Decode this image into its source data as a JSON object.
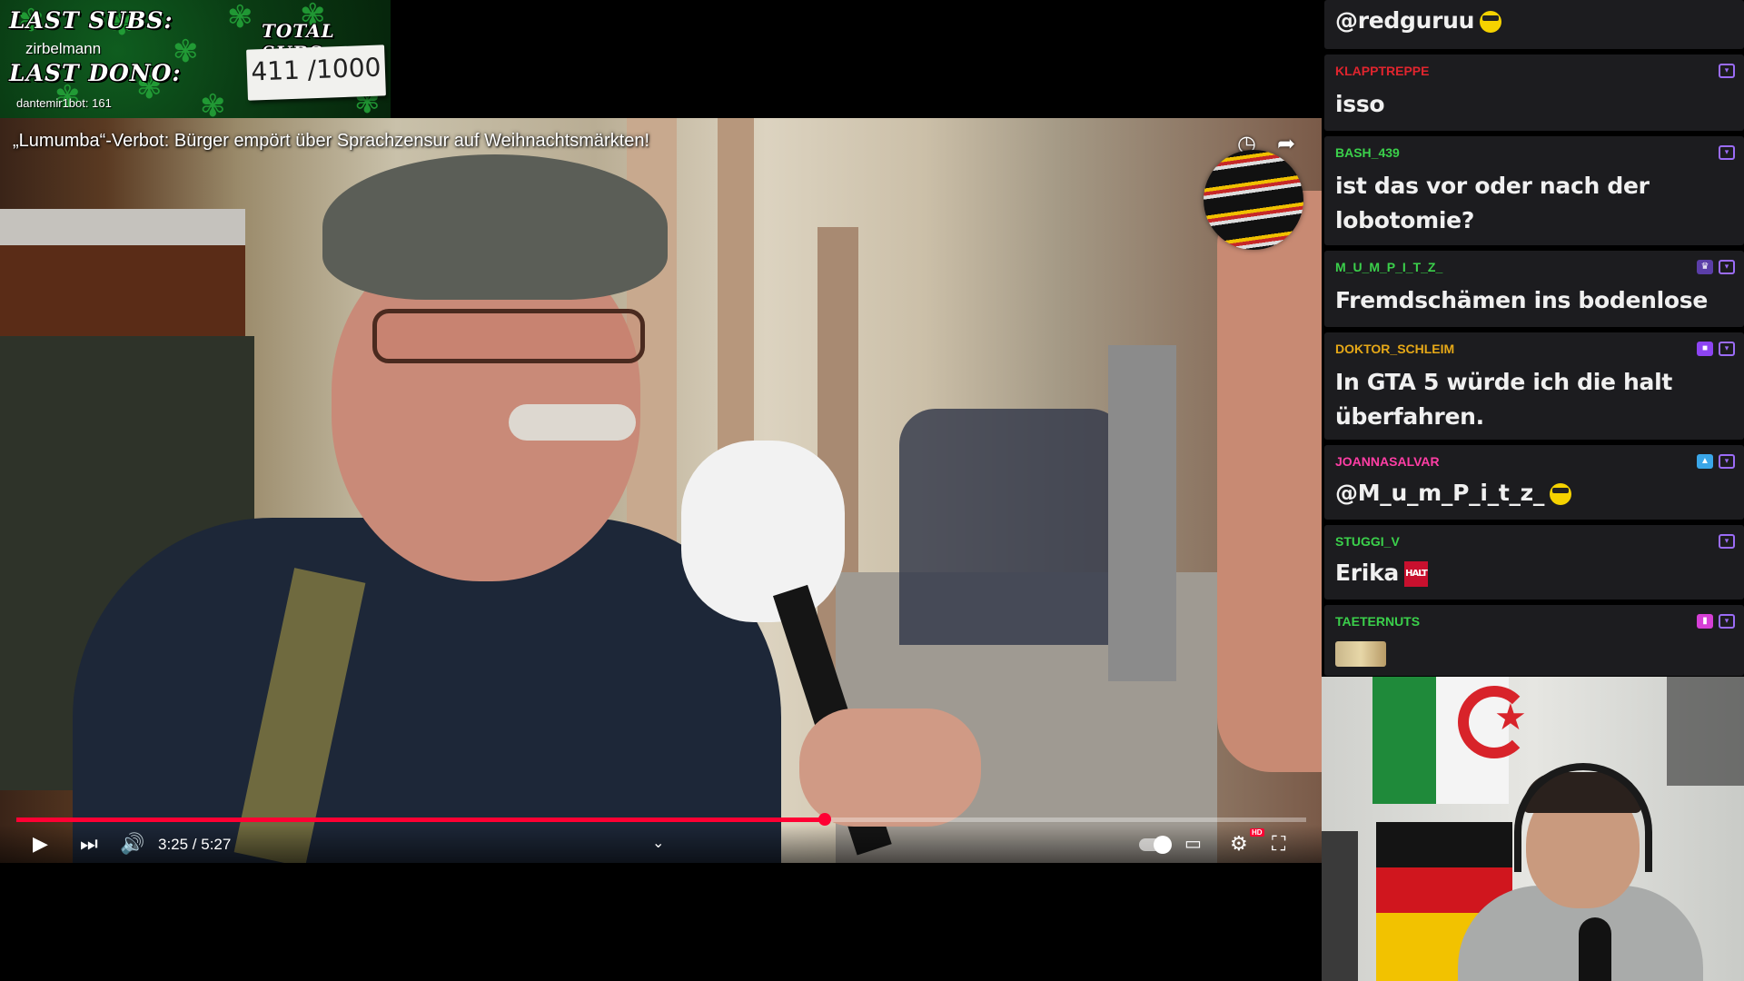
{
  "overlay": {
    "last_subs_label": "LAST SUBS:",
    "last_subs_value": "zirbelmann",
    "last_dono_label": "LAST DONO:",
    "last_dono_value": "dantemir1bot: 161",
    "total_subs_label": "TOTAL SUBS",
    "total_subs_value": "411 /1000"
  },
  "video": {
    "title": "„Lumumba“-Verbot: Bürger empört über Sprachzensur auf Weihnachtsmärkten!",
    "current_time": "3:25",
    "duration": "5:27",
    "time_display": "3:25 / 5:27",
    "progress_fraction": 0.627,
    "icons": {
      "watch_later": "clock-icon",
      "share": "share-icon",
      "play": "play-icon",
      "next": "next-icon",
      "volume": "volume-icon",
      "chapters": "chevron-down-icon",
      "autoplay": "autoplay-toggle",
      "subtitles": "subtitles-icon",
      "settings": "settings-icon",
      "fullscreen_exit": "fullscreen-exit-icon"
    },
    "hd_badge": "HD"
  },
  "chat": {
    "messages": [
      {
        "user": "",
        "user_color": "#ffffff",
        "text": "@redguruu",
        "emote": "face"
      },
      {
        "user": "KLAPPTREPPE",
        "user_color": "#e0252e",
        "text": "isso",
        "emote": ""
      },
      {
        "user": "BASH_439",
        "user_color": "#3bd04b",
        "text": "ist das vor oder nach der lobotomie?",
        "emote": ""
      },
      {
        "user": "M_U_M_P_I_T_Z_",
        "user_color": "#3bd04b",
        "text": "Fremdschämen ins bodenlose",
        "emote": ""
      },
      {
        "user": "DOKTOR_SCHLEIM",
        "user_color": "#e6a817",
        "text": "In GTA 5 würde ich die halt überfahren.",
        "emote": ""
      },
      {
        "user": "JOANNASALVAR",
        "user_color": "#ff3ea5",
        "text": "@M_u_m_P_i_t_z_",
        "emote": "face"
      },
      {
        "user": "STUGGI_V",
        "user_color": "#3bd04b",
        "text": "Erika",
        "emote": "halt"
      },
      {
        "user": "TAETERNUTS",
        "user_color": "#3bd04b",
        "text": "",
        "emote": "image"
      }
    ],
    "halt_emote_text": "HALT"
  },
  "colors": {
    "accent_red": "#ff0033",
    "chat_bg": "#1c1c1f",
    "twitch_purple": "#9b6cf7"
  }
}
